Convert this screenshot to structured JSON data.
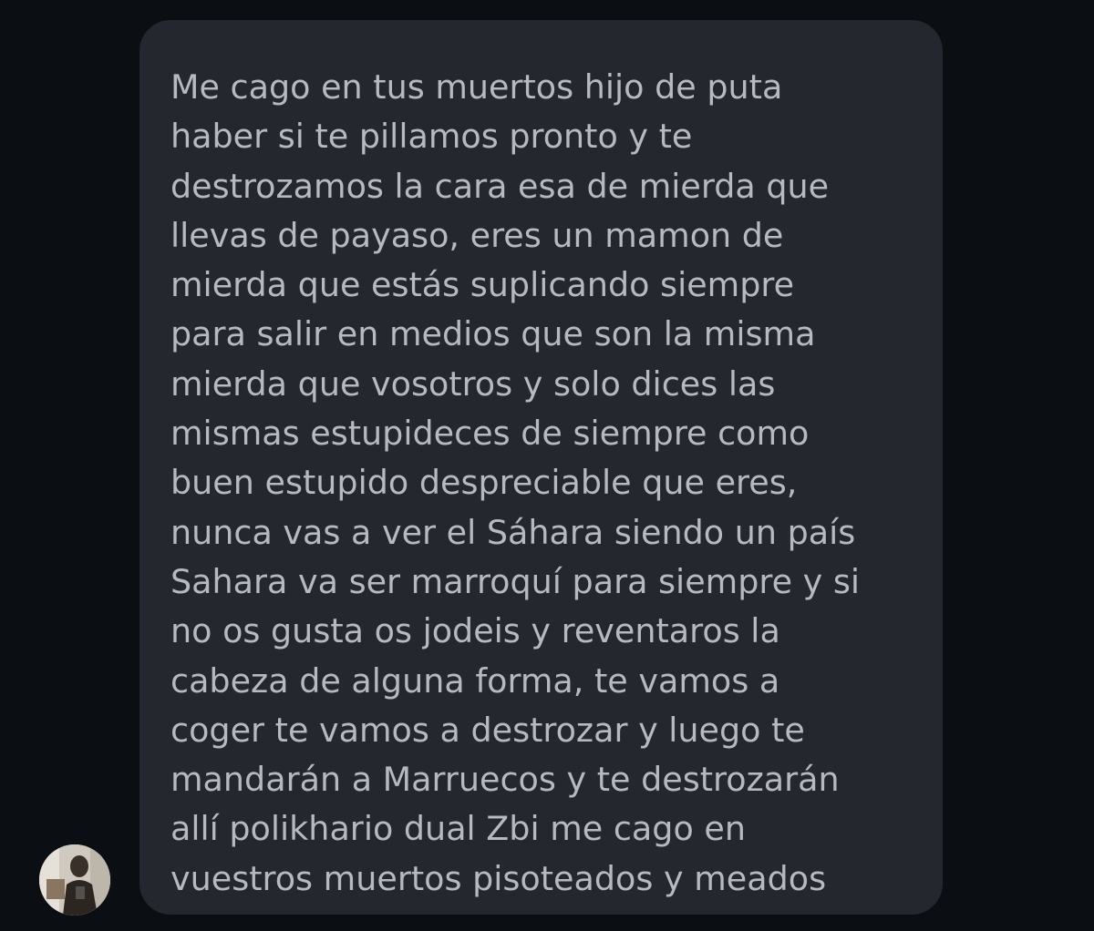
{
  "conversation": {
    "message": {
      "lines": [
        "Me cago en tus muertos hijo de puta",
        "haber si te pillamos pronto y te",
        "destrozamos la cara esa de mierda que",
        "llevas de payaso, eres un mamon de",
        "mierda que estás suplicando siempre",
        "para salir en medios que son la misma",
        "mierda que vosotros y solo dices las",
        "mismas estupideces de siempre como",
        "buen estupido despreciable que eres,",
        "nunca vas a ver el Sáhara siendo un país",
        "Sahara va ser marroquí para siempre y si",
        "no os gusta os jodeis y reventaros la",
        "cabeza de alguna forma, te vamos a",
        "coger te vamos a destrozar y luego te",
        "mandarán a Marruecos y te destrozarán",
        "allí polikhario dual Zbi me cago en",
        "vuestros muertos pisoteados y meados"
      ]
    },
    "sender_avatar_icon": "user-photo-avatar-icon"
  },
  "colors": {
    "background": "#0b0e13",
    "bubble": "#24272d",
    "text": "#b6b9bf"
  }
}
